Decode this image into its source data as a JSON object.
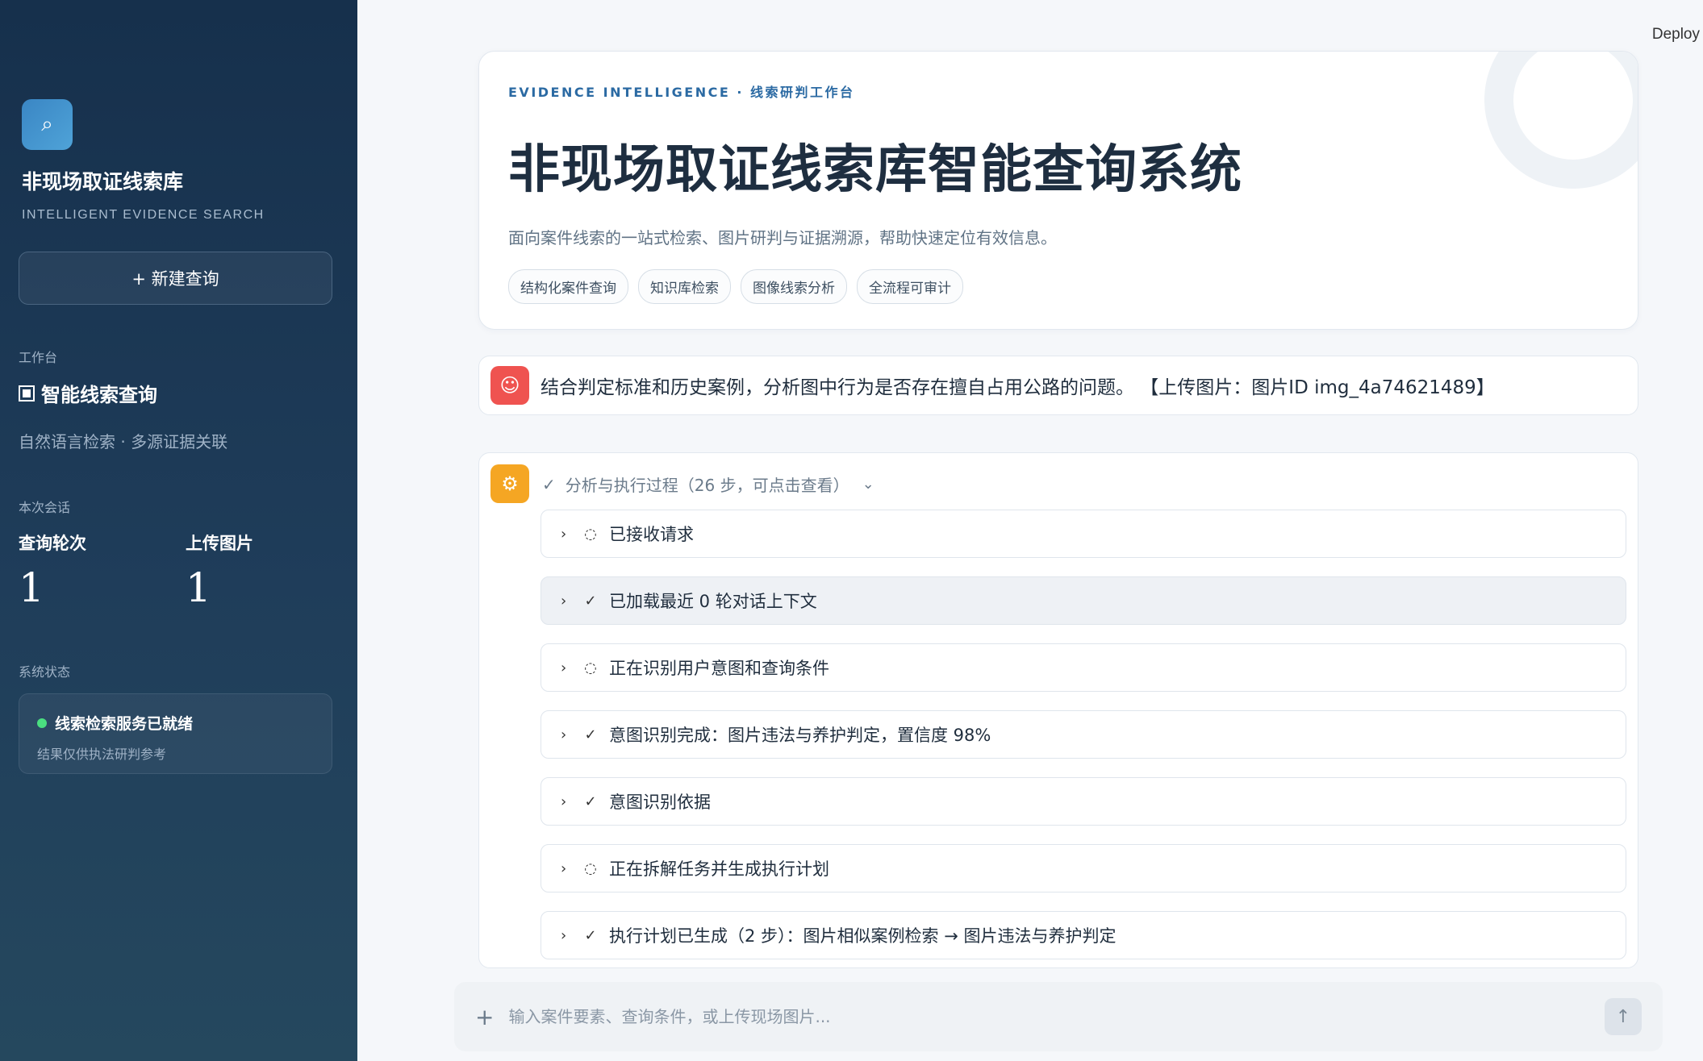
{
  "sidebar": {
    "logo_icon": "search-icon",
    "brand_title": "非现场取证线索库",
    "brand_subtitle": "INTELLIGENT EVIDENCE SEARCH",
    "new_query_label": "+ 新建查询",
    "workbench_section": "工作台",
    "workbench_item": "智能线索查询",
    "workbench_desc": "自然语言检索 · 多源证据关联",
    "session_section": "本次会话",
    "stats": [
      {
        "label": "查询轮次",
        "value": "1"
      },
      {
        "label": "上传图片",
        "value": "1"
      }
    ],
    "system_section": "系统状态",
    "status_title": "线索检索服务已就绪",
    "status_note": "结果仅供执法研判参考",
    "status_color": "#4ade80"
  },
  "header": {
    "deploy_label": "Deploy"
  },
  "hero": {
    "eyebrow": "EVIDENCE INTELLIGENCE · 线索研判工作台",
    "title": "非现场取证线索库智能查询系统",
    "description": "面向案件线索的一站式检索、图片研判与证据溯源，帮助快速定位有效信息。",
    "tags": [
      "结构化案件查询",
      "知识库检索",
      "图像线索分析",
      "全流程可审计"
    ]
  },
  "user_message": {
    "avatar_icon": "user-face-icon",
    "text": "结合判定标准和历史案例，分析图中行为是否存在擅自占用公路的问题。 【上传图片：图片ID img_4a74621489】"
  },
  "assistant": {
    "avatar_icon": "robot-icon",
    "process_label": "分析与执行过程（26 步，可点击查看）",
    "steps": [
      {
        "icon": "spinner",
        "text": "已接收请求"
      },
      {
        "icon": "check-circle",
        "text": "已加载最近 0 轮对话上下文"
      },
      {
        "icon": "spinner",
        "text": "正在识别用户意图和查询条件"
      },
      {
        "icon": "check-circle",
        "text": "意图识别完成：图片违法与养护判定，置信度 98%"
      },
      {
        "icon": "check-circle",
        "text": "意图识别依据"
      },
      {
        "icon": "spinner",
        "text": "正在拆解任务并生成执行计划"
      },
      {
        "icon": "check-circle",
        "text": "执行计划已生成（2 步）：图片相似案例检索 → 图片违法与养护判定"
      }
    ]
  },
  "composer": {
    "placeholder": "输入案件要素、查询条件，或上传现场图片..."
  },
  "colors": {
    "sidebar_top": "#16304c",
    "accent": "#2b6aa3",
    "user_avatar": "#ef5350",
    "bot_avatar": "#f5a623"
  }
}
